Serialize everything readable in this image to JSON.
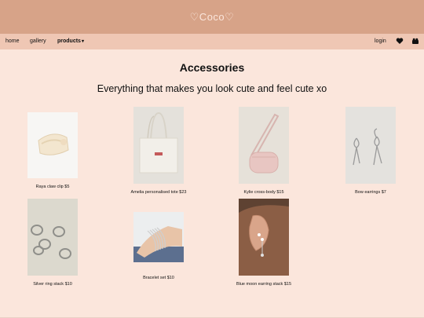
{
  "header": {
    "brand": "♡Coco♡"
  },
  "nav": {
    "left": [
      {
        "label": "home"
      },
      {
        "label": "gallery"
      },
      {
        "label": "products",
        "caret": "▾"
      }
    ],
    "right": {
      "login": "login"
    }
  },
  "page": {
    "title": "Accessories",
    "subtitle": "Everything that makes you look cute and feel cute xo"
  },
  "products": [
    {
      "caption": "Raya claw clip $5",
      "image": "claw-clip"
    },
    {
      "caption": "Amelia personalised tote $23",
      "image": "tote-bag"
    },
    {
      "caption": "Kylie cross-body $15",
      "image": "crossbody-bag"
    },
    {
      "caption": "Bow earrings $7",
      "image": "bow-earrings"
    },
    {
      "caption": "Silver ring stack $10",
      "image": "ring-stack"
    },
    {
      "caption": "Bracelet set $10",
      "image": "bracelet-set"
    },
    {
      "caption": "Blue moon earring stack $15",
      "image": "earring-stack"
    }
  ]
}
